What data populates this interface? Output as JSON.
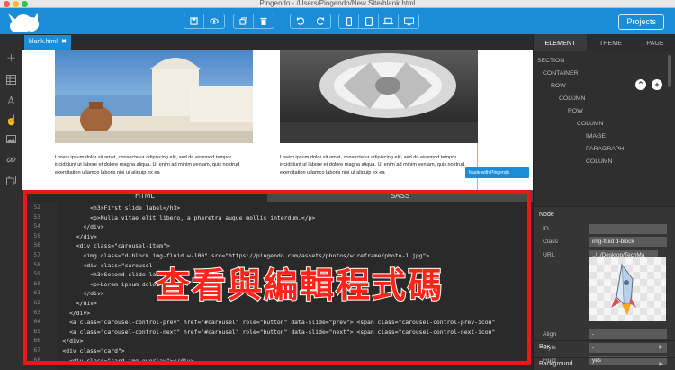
{
  "window": {
    "title": "Pingendo - /Users/Pingendo/New Site/blank.html"
  },
  "toolbar": {
    "projects_label": "Projects",
    "groups": [
      {
        "name": "file",
        "buttons": [
          "save-icon",
          "preview-icon",
          "copy-icon",
          "delete-icon"
        ]
      },
      {
        "name": "history",
        "buttons": [
          "undo-icon",
          "redo-icon"
        ]
      },
      {
        "name": "devices",
        "buttons": [
          "phone-icon",
          "tablet-icon",
          "laptop-icon",
          "desktop-icon"
        ]
      }
    ]
  },
  "leftbar": {
    "icons": [
      "add-icon",
      "grid-icon",
      "text-icon",
      "pointer-icon",
      "image-icon",
      "link-icon",
      "copy-icon"
    ]
  },
  "tabs": {
    "file_tab": "blank.html",
    "close": "✖"
  },
  "canvas": {
    "card_text_left": "Lorem ipsum dolor sit amet, consectetur adipiscing elit, sed do eiusmod tempor incididunt ut labore et dolore magna aliqua. Ut enim ad minim veniam, quis nostrud exercitation ullamco laboris nisi ut aliquip ex ea",
    "card_text_right": "Lorem ipsum dolor sit amet, consectetur adipiscing elit, sed do eiusmod tempor incididunt ut labore et dolore magna aliqua. Ut enim ad minim veniam, quis nostrud exercitation ullamco laboris nisi ut aliquip ex ea",
    "made_with": "Made with Pingendo"
  },
  "editor": {
    "tab_html": "HTML",
    "tab_sass": "SASS",
    "line_numbers": [
      "52",
      "53",
      "54",
      "55",
      "56",
      "57",
      "58",
      "59",
      "60",
      "61",
      "62",
      "63",
      "64",
      "65",
      "66",
      "67",
      "68"
    ],
    "lines": [
      "            <h3>First slide label</h3>",
      "            <p>Nulla vitae elit libero, a pharetra augue mollis interdum.</p>",
      "          </div>",
      "        </div>",
      "        <div class=\"carousel-item\">",
      "          <img class=\"d-block img-fluid w-100\" src=\"https://pingendo.com/assets/photos/wireframe/photo-1.jpg\">",
      "          <div class=\"carousel-",
      "            <h3>Second slide labe",
      "            <p>Lorem ipsum dolor",
      "          </div>",
      "        </div>",
      "      </div>",
      "      <a class=\"carousel-control-prev\" href=\"#carousel\" role=\"button\" data-slide=\"prev\"> <span class=\"carousel-control-prev-icon\"",
      "      <a class=\"carousel-control-next\" href=\"#carousel\" role=\"button\" data-slide=\"next\"> <span class=\"carousel-control-next-icon\"",
      "    </div>",
      "    <div class=\"card\">",
      "      <div class=\"card-img-overlay\"></div>"
    ],
    "overlay_caption": "查看與編輯程式碼"
  },
  "panel": {
    "tabs": [
      "ELEMENT",
      "THEME",
      "PAGE"
    ],
    "tree": [
      "SECTION",
      "CONTAINER",
      "ROW",
      "COLUMN",
      "ROW",
      "COLUMN",
      "IMAGE",
      "PARAGRAPH",
      "COLUMN"
    ],
    "node": {
      "header": "Node",
      "id_label": "ID",
      "id_value": "",
      "class_label": "Class",
      "class_value": "img-fluid d-block",
      "url_label": "URL",
      "url_value": "../../Desktop/TechMa",
      "align_label": "Align",
      "align_value": "-",
      "style_label": "Style",
      "style_value": "-",
      "fluid_label": "Fluid",
      "fluid_value": "yes"
    },
    "sections": [
      "Box",
      "Background"
    ]
  },
  "colors": {
    "brand": "#1a8cd8",
    "highlight": "#e41b17",
    "editor_bg": "#2a2a2a",
    "panel_bg": "#333333"
  }
}
